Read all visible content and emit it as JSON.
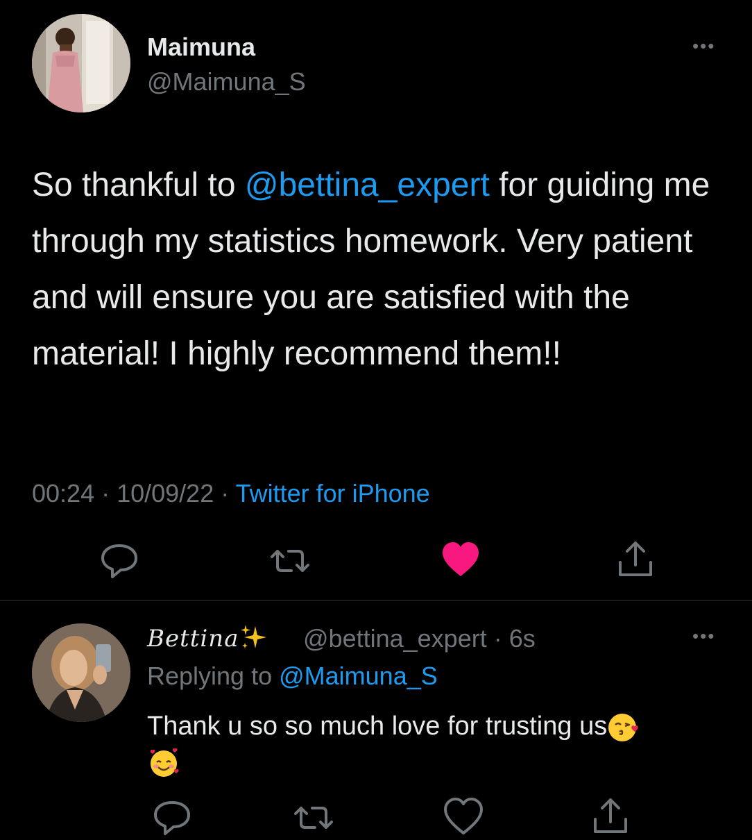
{
  "tweet": {
    "author_name": "Maimuna",
    "author_handle": "@Maimuna_S",
    "more_label": "•••",
    "text_before": "So thankful to ",
    "mention": "@bettina_expert",
    "text_after": " for guiding me through my statistics homework. Very patient and will ensure you are satisfied with the material! I highly recommend them!!",
    "time": "00:24",
    "date": "10/09/22",
    "separator": " · ",
    "source": "Twitter for iPhone",
    "liked": true,
    "icons": [
      "reply-icon",
      "retweet-icon",
      "like-icon",
      "share-icon"
    ]
  },
  "reply": {
    "author_name": "Bettina",
    "author_handle": "@bettina_expert",
    "age": "· 6s",
    "replying_prefix": "Replying to ",
    "replying_to": "@Maimuna_S",
    "more_label": "•••",
    "text": "Thank u so so much love for trusting us",
    "emojis": [
      "face-blowing-kiss-emoji",
      "smiling-face-with-hearts-emoji"
    ],
    "liked": false,
    "icons": [
      "reply-icon",
      "retweet-icon",
      "like-icon",
      "share-icon"
    ]
  },
  "colors": {
    "background": "#000000",
    "primary_text": "#e7e9ea",
    "secondary_text": "#71767b",
    "accent": "#1d9bf0",
    "like": "#f91880",
    "divider": "#2f3336"
  }
}
